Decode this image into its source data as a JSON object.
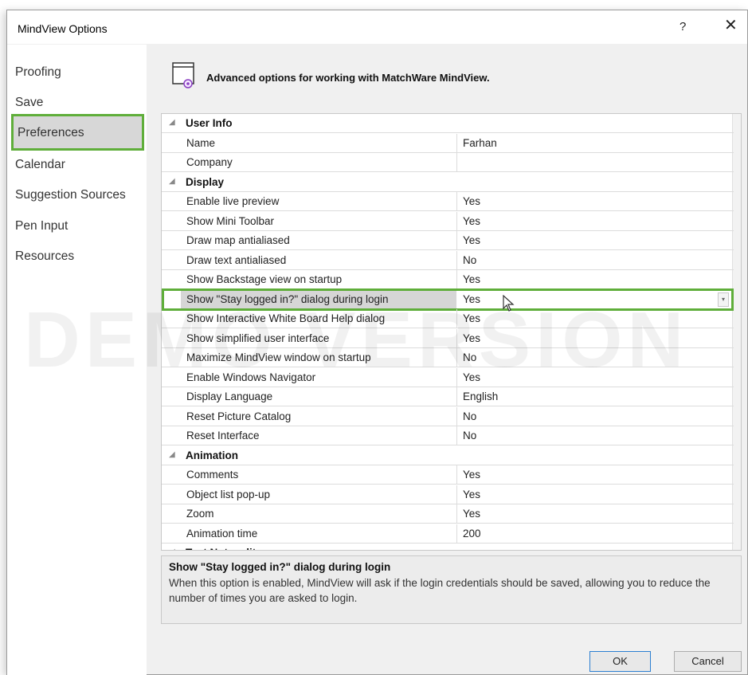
{
  "window": {
    "title": "MindView Options",
    "help_label": "?",
    "close_label": "✕"
  },
  "nav": {
    "items": [
      "Proofing",
      "Save",
      "Preferences",
      "Calendar",
      "Suggestion Sources",
      "Pen Input",
      "Resources"
    ],
    "selected": "Preferences"
  },
  "header": {
    "text": "Advanced options for working with MatchWare MindView.",
    "icon": "options-window-gear-icon"
  },
  "grid": {
    "groups": [
      {
        "label": "User Info",
        "rows": [
          {
            "name": "Name",
            "value": "Farhan"
          },
          {
            "name": "Company",
            "value": ""
          }
        ]
      },
      {
        "label": "Display",
        "rows": [
          {
            "name": "Enable live preview",
            "value": "Yes"
          },
          {
            "name": "Show Mini Toolbar",
            "value": "Yes"
          },
          {
            "name": "Draw map antialiased",
            "value": "Yes"
          },
          {
            "name": "Draw text antialiased",
            "value": "No"
          },
          {
            "name": "Show Backstage view on startup",
            "value": "Yes"
          },
          {
            "name": "Show \"Stay logged in?\" dialog during login",
            "value": "Yes"
          },
          {
            "name": "Show Interactive White Board Help dialog",
            "value": "Yes"
          },
          {
            "name": "Show simplified user interface",
            "value": "Yes"
          },
          {
            "name": "Maximize MindView window on startup",
            "value": "No"
          },
          {
            "name": "Enable Windows Navigator",
            "value": "Yes"
          },
          {
            "name": "Display Language",
            "value": "English"
          },
          {
            "name": "Reset Picture Catalog",
            "value": "No"
          },
          {
            "name": "Reset Interface",
            "value": "No"
          }
        ]
      },
      {
        "label": "Animation",
        "rows": [
          {
            "name": "Comments",
            "value": "Yes"
          },
          {
            "name": "Object list pop-up",
            "value": "Yes"
          },
          {
            "name": "Zoom",
            "value": "Yes"
          },
          {
            "name": "Animation time",
            "value": "200"
          }
        ]
      },
      {
        "label": "Text Note editor",
        "rows": []
      }
    ],
    "selected_row": "Show \"Stay logged in?\" dialog during login"
  },
  "description": {
    "title": "Show \"Stay logged in?\" dialog during login",
    "text": "When this option is enabled, MindView will ask if the login credentials should be saved, allowing you to reduce the number of times you are asked to login."
  },
  "watermark": "DEMO VERSION",
  "buttons": {
    "ok": "OK",
    "cancel": "Cancel"
  },
  "colors": {
    "highlight_border": "#5fae3a",
    "selection_bg": "#d6d6d6",
    "dialog_bg": "#f0f0f0"
  }
}
